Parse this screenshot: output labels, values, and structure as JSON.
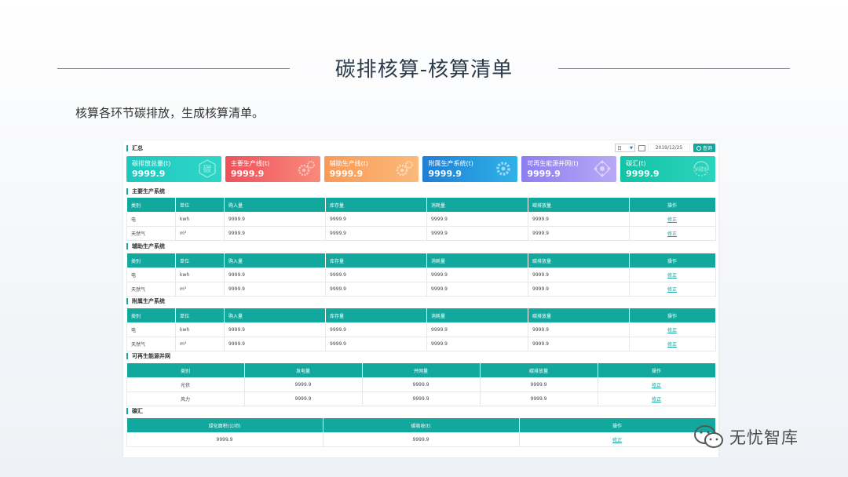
{
  "slide": {
    "title": "碳排核算-核算清单",
    "subtitle": "核算各环节碳排放，生成核算清单。"
  },
  "summary": {
    "heading": "汇总",
    "select_value": "日",
    "date": "2019/12/25",
    "query_label": "查询",
    "cards": [
      {
        "label": "碳排放总量(t)",
        "value": "9999.9",
        "icon": "carbon-char-icon",
        "deco_text": "碳"
      },
      {
        "label": "主要生产线(t)",
        "value": "9999.9",
        "icon": "gears-icon"
      },
      {
        "label": "辅助生产线(t)",
        "value": "9999.9",
        "icon": "gears-icon"
      },
      {
        "label": "附属生产系统(t)",
        "value": "9999.9",
        "icon": "gear-icon"
      },
      {
        "label": "可再生能源并网(t)",
        "value": "9999.9",
        "icon": "network-icon"
      },
      {
        "label": "碳汇(t)",
        "value": "9999.9",
        "icon": "carbon-sink-icon",
        "deco_text": "¥碳$"
      }
    ]
  },
  "std_columns": [
    "类别",
    "单位",
    "购入量",
    "库存量",
    "消耗量",
    "碳排放量",
    "操作"
  ],
  "sections": [
    {
      "heading": "主要生产系统",
      "rows": [
        [
          "电",
          "kwh",
          "9999.9",
          "9999.9",
          "9999.9",
          "9999.9",
          "修正"
        ],
        [
          "天然气",
          "m³",
          "9999.9",
          "9999.9",
          "9999.9",
          "9999.9",
          "修正"
        ]
      ]
    },
    {
      "heading": "辅助生产系统",
      "rows": [
        [
          "电",
          "kwh",
          "9999.9",
          "9999.9",
          "9999.9",
          "9999.9",
          "修正"
        ],
        [
          "天然气",
          "m³",
          "9999.9",
          "9999.9",
          "9999.9",
          "9999.9",
          "修正"
        ]
      ]
    },
    {
      "heading": "附属生产系统",
      "rows": [
        [
          "电",
          "kwh",
          "9999.9",
          "9999.9",
          "9999.9",
          "9999.9",
          "修正"
        ],
        [
          "天然气",
          "m³",
          "9999.9",
          "9999.9",
          "9999.9",
          "9999.9",
          "修正"
        ]
      ]
    }
  ],
  "renewable": {
    "heading": "可再生能源并网",
    "columns": [
      "类别",
      "发电量",
      "并网量",
      "碳排放量",
      "操作"
    ],
    "rows": [
      [
        "光伏",
        "9999.9",
        "9999.9",
        "9999.9",
        "修正"
      ],
      [
        "风力",
        "9999.9",
        "9999.9",
        "9999.9",
        "修正"
      ]
    ]
  },
  "sink": {
    "heading": "碳汇",
    "columns": [
      "绿化面积(公顷)",
      "碳吸收(t)",
      "操作"
    ],
    "rows": [
      [
        "9999.9",
        "9999.9",
        "修正"
      ]
    ]
  },
  "watermark": {
    "text": "无忧智库"
  }
}
